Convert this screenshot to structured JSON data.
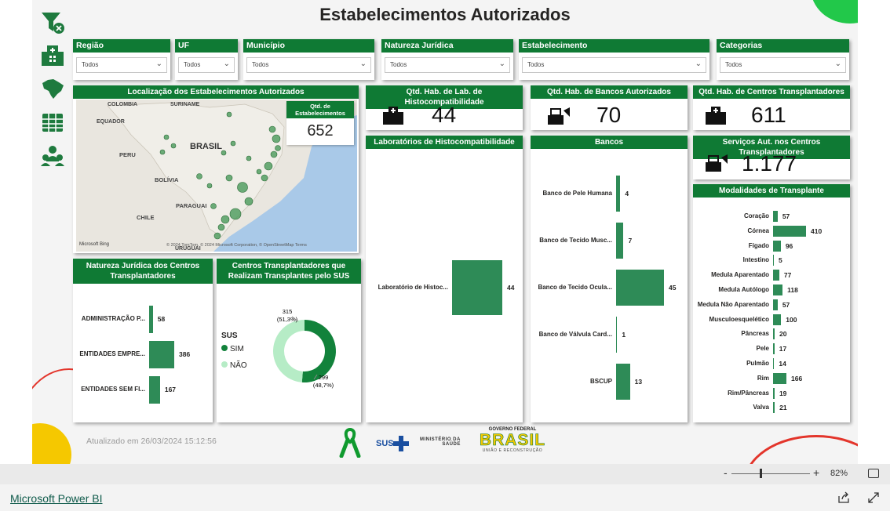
{
  "header": {
    "title": "Estabelecimentos Autorizados"
  },
  "nav": [
    "clear-filter-icon",
    "hospital-icon",
    "brazil-map-icon",
    "table-icon",
    "people-icon"
  ],
  "filters": [
    {
      "label": "Região",
      "value": "Todos"
    },
    {
      "label": "UF",
      "value": "Todos"
    },
    {
      "label": "Município",
      "value": "Todos"
    },
    {
      "label": "Natureza Jurídica",
      "value": "Todos"
    },
    {
      "label": "Estabelecimento",
      "value": "Todos"
    },
    {
      "label": "Categorias",
      "value": "Todos"
    }
  ],
  "map": {
    "title": "Localização dos Estabelecimentos Autorizados",
    "labels": {
      "colombia": "COLOMBIA",
      "suriname": "SURINAME",
      "equador": "EQUADOR",
      "brasil": "BRASIL",
      "peru": "PERU",
      "bolivia": "BOLÍVIA",
      "paraguai": "PARAGUAI",
      "chile": "CHILE",
      "uruguai": "URUGUAI"
    },
    "kpi_label": "Qtd. de Estabelecimentos",
    "kpi_value": "652",
    "attribution": "© 2024 TomTom, © 2024 Microsoft Corporation, © OpenStreetMap  Terms",
    "bing": "Microsoft Bing"
  },
  "kpis": {
    "labs": {
      "label": "Qtd. Hab. de Lab. de Histocompatibilidade",
      "value": "44"
    },
    "banks": {
      "label": "Qtd. Hab. de Bancos Autorizados",
      "value": "70"
    },
    "centers": {
      "label": "Qtd. Hab. de Centros Transplantadores",
      "value": "611"
    },
    "services": {
      "label": "Serviços Aut. nos Centros Transplantadores",
      "value": "1.177"
    }
  },
  "labs_chart": {
    "title": "Laboratórios de Histocompatibilidade",
    "chart_data": {
      "type": "bar",
      "categories": [
        "Laboratório de Histoc..."
      ],
      "values": [
        44
      ]
    }
  },
  "banks_chart": {
    "title": "Bancos",
    "chart_data": {
      "type": "bar",
      "categories": [
        "Banco de Pele Humana",
        "Banco de Tecido Musc...",
        "Banco de Tecido Ocula...",
        "Banco de Válvula Card...",
        "BSCUP"
      ],
      "values": [
        4,
        7,
        45,
        1,
        13
      ]
    }
  },
  "modalidades_chart": {
    "title": "Modalidades de Transplante",
    "chart_data": {
      "type": "bar",
      "categories": [
        "Coração",
        "Córnea",
        "Fígado",
        "Intestino",
        "Medula Aparentado",
        "Medula Autólogo",
        "Medula Não Aparentado",
        "Musculoesquelético",
        "Pâncreas",
        "Pele",
        "Pulmão",
        "Rim",
        "Rim/Pâncreas",
        "Valva"
      ],
      "values": [
        57,
        410,
        96,
        5,
        77,
        118,
        57,
        100,
        20,
        17,
        14,
        166,
        19,
        21
      ]
    }
  },
  "natureza_chart": {
    "title": "Natureza Jurídica dos Centros Transplantadores",
    "chart_data": {
      "type": "bar",
      "categories": [
        "ADMINISTRAÇÃO P...",
        "ENTIDADES EMPRE...",
        "ENTIDADES SEM FI..."
      ],
      "values": [
        58,
        386,
        167
      ]
    }
  },
  "sus_chart": {
    "title": "Centros Transplantadores que Realizam Transplantes pelo SUS",
    "legend_title": "SUS",
    "chart_data": {
      "type": "pie",
      "categories": [
        "SIM",
        "NÃO"
      ],
      "values": [
        315,
        299
      ],
      "percent_labels": [
        "(51,3%)",
        "(48,7%)"
      ],
      "colors": [
        "#12823b",
        "#b6ecc6"
      ]
    }
  },
  "footer": {
    "updated": "Atualizado em 26/03/2024 15:12:56",
    "sus_logo": "SUS",
    "ministerio_line1": "MINISTÉRIO DA",
    "ministerio_line2": "SAÚDE",
    "gov_line1": "GOVERNO FEDERAL",
    "gov_brasil": "BRASIL",
    "gov_line2": "UNIÃO E RECONSTRUÇÃO"
  },
  "statusbar": {
    "zoom_minus": "-",
    "zoom_plus": "+",
    "zoom": "82%"
  },
  "bottombar": {
    "link": "Microsoft Power BI"
  },
  "colors": {
    "accent": "#0f7a34",
    "bar": "#2e8b57"
  }
}
